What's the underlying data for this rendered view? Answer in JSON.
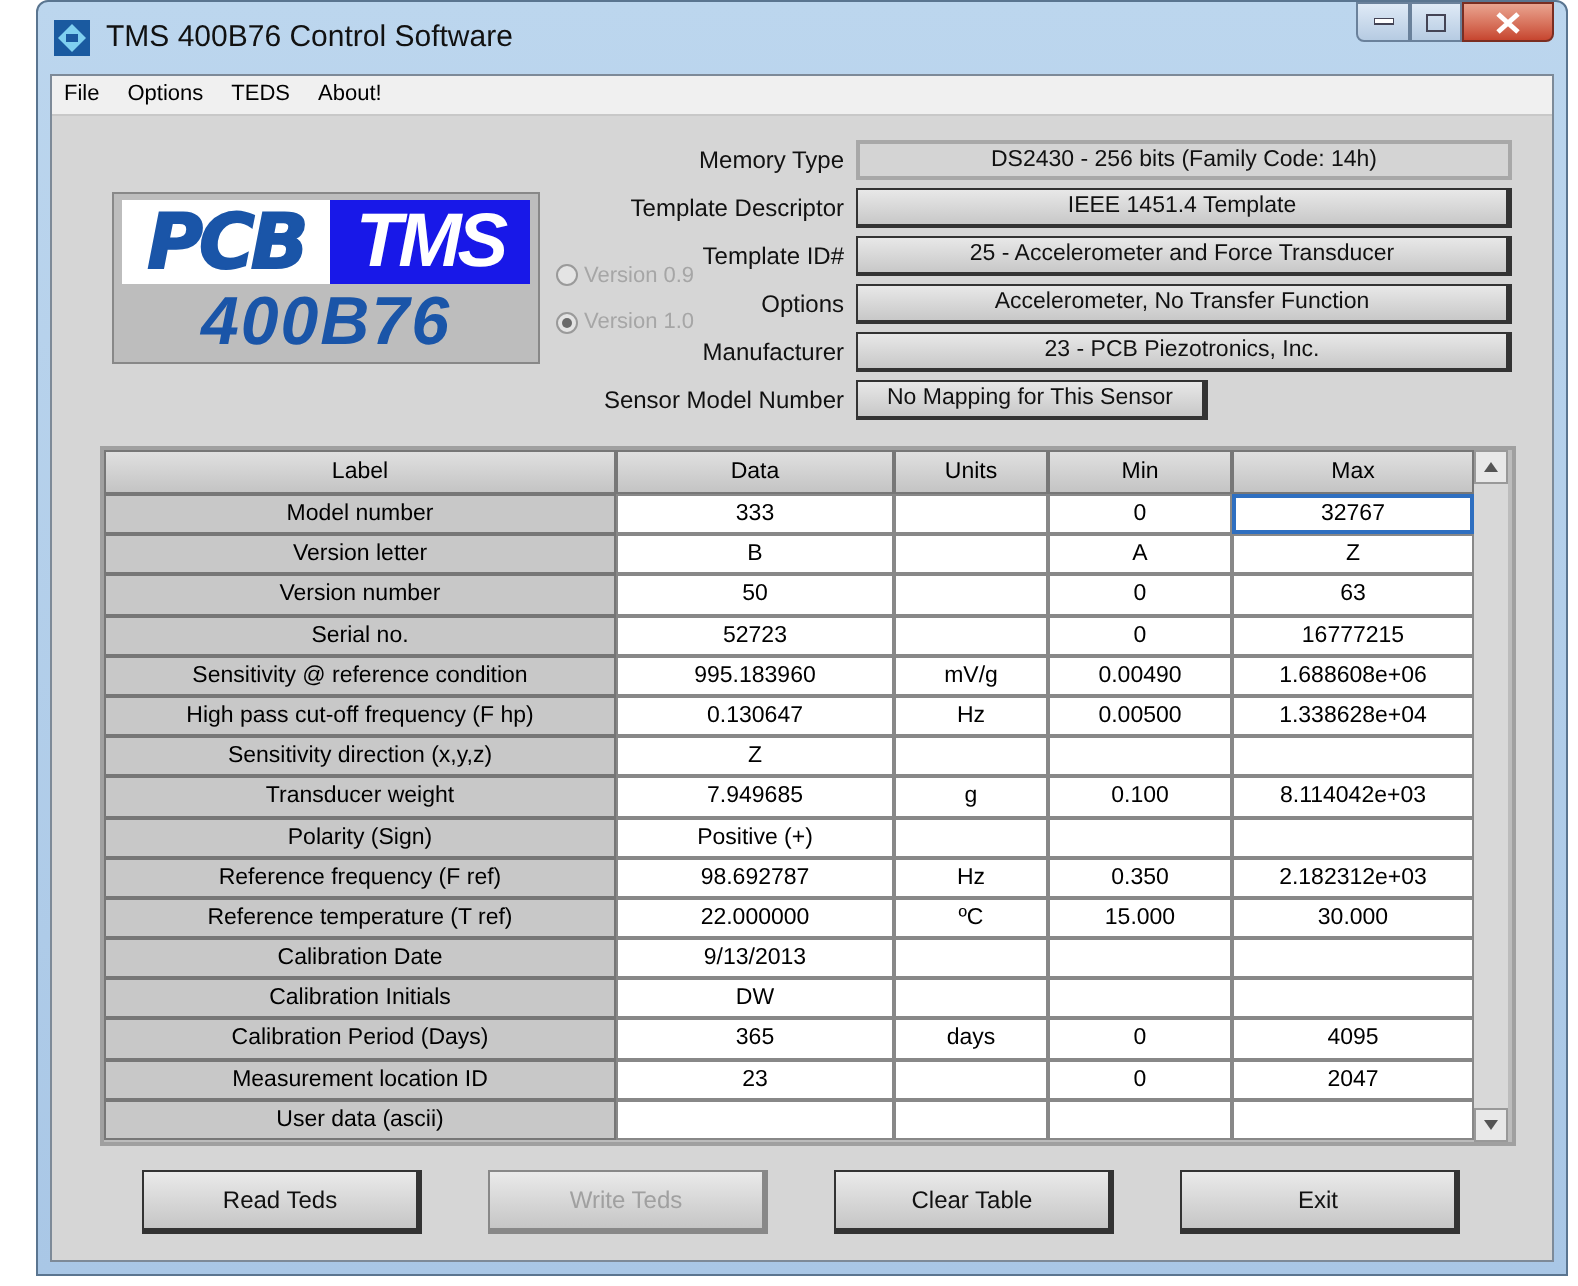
{
  "window": {
    "title": "TMS 400B76 Control Software"
  },
  "menu": [
    {
      "label": "File"
    },
    {
      "label": "Options"
    },
    {
      "label": "TEDS"
    },
    {
      "label": "About!"
    }
  ],
  "logo": {
    "top_left": "PCB",
    "top_right": "TMS",
    "bottom": "400B76"
  },
  "versions": [
    {
      "label": "Version 0.9",
      "selected": false,
      "disabled": true
    },
    {
      "label": "Version 1.0",
      "selected": true,
      "disabled": true
    }
  ],
  "fields": [
    {
      "label": "Memory Type",
      "value": "DS2430 - 256 bits (Family Code: 14h)",
      "kind": "display"
    },
    {
      "label": "Template Descriptor",
      "value": "IEEE 1451.4 Template",
      "kind": "button"
    },
    {
      "label": "Template ID#",
      "value": "25 - Accelerometer and Force Transducer",
      "kind": "button"
    },
    {
      "label": "Options",
      "value": "Accelerometer, No Transfer Function",
      "kind": "button"
    },
    {
      "label": "Manufacturer",
      "value": "23 - PCB Piezotronics, Inc.",
      "kind": "button"
    },
    {
      "label": "Sensor Model Number",
      "value": "No Mapping for This Sensor",
      "kind": "short_button"
    }
  ],
  "table": {
    "columns": [
      "Label",
      "Data",
      "Units",
      "Min",
      "Max"
    ],
    "rows": [
      {
        "cells": [
          "Model number",
          "333",
          "",
          "0",
          "32767"
        ],
        "focused": true
      },
      {
        "cells": [
          "Version letter",
          "B",
          "",
          "A",
          "Z"
        ],
        "focused": false
      },
      {
        "cells": [
          "Version number",
          "50",
          "",
          "0",
          "63"
        ],
        "focused": false
      },
      {
        "cells": [
          "Serial no.",
          "52723",
          "",
          "0",
          "16777215"
        ],
        "focused": false
      },
      {
        "cells": [
          "Sensitivity @ reference condition",
          "995.183960",
          "mV/g",
          "0.00490",
          "1.688608e+06"
        ],
        "focused": false
      },
      {
        "cells": [
          "High pass cut-off frequency (F hp)",
          "0.130647",
          "Hz",
          "0.00500",
          "1.338628e+04"
        ],
        "focused": false
      },
      {
        "cells": [
          "Sensitivity direction (x,y,z)",
          "Z",
          "",
          "",
          ""
        ],
        "focused": false
      },
      {
        "cells": [
          "Transducer weight",
          "7.949685",
          "g",
          "0.100",
          "8.114042e+03"
        ],
        "focused": false
      },
      {
        "cells": [
          "Polarity (Sign)",
          "Positive (+)",
          "",
          "",
          ""
        ],
        "focused": false
      },
      {
        "cells": [
          "Reference frequency (F ref)",
          "98.692787",
          "Hz",
          "0.350",
          "2.182312e+03"
        ],
        "focused": false
      },
      {
        "cells": [
          "Reference temperature (T ref)",
          "22.000000",
          "ºC",
          "15.000",
          "30.000"
        ],
        "focused": false
      },
      {
        "cells": [
          "Calibration Date",
          "9/13/2013",
          "",
          "",
          ""
        ],
        "focused": false
      },
      {
        "cells": [
          "Calibration Initials",
          "DW",
          "",
          "",
          ""
        ],
        "focused": false
      },
      {
        "cells": [
          "Calibration Period (Days)",
          "365",
          "days",
          "0",
          "4095"
        ],
        "focused": false
      },
      {
        "cells": [
          "Measurement location ID",
          "23",
          "",
          "0",
          "2047"
        ],
        "focused": false
      },
      {
        "cells": [
          "User data (ascii)",
          "",
          "",
          "",
          ""
        ],
        "focused": false
      }
    ]
  },
  "buttons": [
    {
      "label": "Read Teds",
      "disabled": false
    },
    {
      "label": "Write Teds",
      "disabled": true
    },
    {
      "label": "Clear Table",
      "disabled": false
    },
    {
      "label": "Exit",
      "disabled": false
    }
  ]
}
